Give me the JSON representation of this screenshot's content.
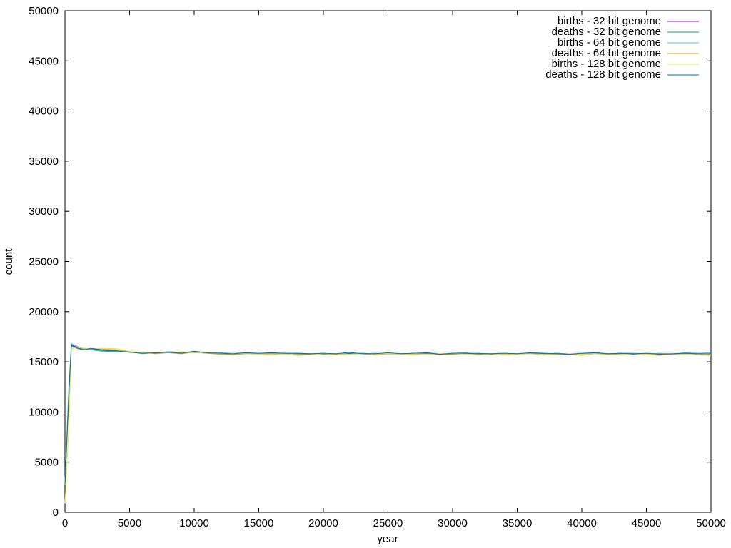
{
  "chart_data": {
    "type": "line",
    "title": "",
    "xlabel": "year",
    "ylabel": "count",
    "xlim": [
      0,
      50000
    ],
    "ylim": [
      0,
      50000
    ],
    "x_ticks": [
      "0",
      "5000",
      "10000",
      "15000",
      "20000",
      "25000",
      "30000",
      "35000",
      "40000",
      "45000",
      "50000"
    ],
    "y_ticks": [
      "0",
      "5000",
      "10000",
      "15000",
      "20000",
      "25000",
      "30000",
      "35000",
      "40000",
      "45000",
      "50000"
    ],
    "grid": false,
    "legend_position": "top-right",
    "x": [
      0,
      300,
      500,
      1000,
      1500,
      2000,
      3000,
      4000,
      5000,
      6000,
      7000,
      8000,
      9000,
      10000,
      11000,
      12000,
      13000,
      14000,
      15000,
      16000,
      17000,
      18000,
      19000,
      20000,
      21000,
      22000,
      23000,
      24000,
      25000,
      26000,
      27000,
      28000,
      29000,
      30000,
      31000,
      32000,
      33000,
      34000,
      35000,
      36000,
      37000,
      38000,
      39000,
      40000,
      41000,
      42000,
      43000,
      44000,
      45000,
      46000,
      47000,
      48000,
      49000,
      50000
    ],
    "series": [
      {
        "name": "births - 32 bit genome",
        "color": "#9400d3",
        "values": [
          2800,
          12000,
          16700,
          16400,
          16200,
          16300,
          16100,
          16000,
          16000,
          15900,
          15850,
          16000,
          15950,
          15900,
          15900,
          15850,
          15800,
          15850,
          15800,
          15850,
          15850,
          15800,
          15750,
          15800,
          15800,
          15850,
          15800,
          15800,
          15850,
          15800,
          15800,
          15850,
          15700,
          15800,
          15800,
          15800,
          15750,
          15800,
          15800,
          15850,
          15800,
          15800,
          15700,
          15800,
          15900,
          15800,
          15750,
          15800,
          15800,
          15700,
          15700,
          15800,
          15800,
          15700
        ]
      },
      {
        "name": "deaths - 32 bit genome",
        "color": "#009e73",
        "values": [
          2800,
          11500,
          16600,
          16300,
          16200,
          16250,
          16100,
          16050,
          15950,
          15900,
          15900,
          15950,
          15900,
          15950,
          15850,
          15800,
          15800,
          15850,
          15800,
          15800,
          15850,
          15800,
          15800,
          15750,
          15800,
          15800,
          15850,
          15800,
          15800,
          15800,
          15850,
          15800,
          15750,
          15800,
          15800,
          15850,
          15800,
          15800,
          15800,
          15800,
          15800,
          15850,
          15800,
          15700,
          15850,
          15800,
          15800,
          15750,
          15800,
          15800,
          15750,
          15800,
          15800,
          15750
        ]
      },
      {
        "name": "births - 64 bit genome",
        "color": "#56b4e9",
        "values": [
          3000,
          12500,
          16800,
          16500,
          16300,
          16200,
          16000,
          16000,
          16000,
          15800,
          15900,
          16000,
          15900,
          16000,
          15900,
          15900,
          15850,
          15900,
          15800,
          15900,
          15800,
          15850,
          15800,
          15850,
          15750,
          15900,
          15800,
          15850,
          15800,
          15800,
          15800,
          15900,
          15800,
          15850,
          15900,
          15800,
          15800,
          15850,
          15800,
          15900,
          15850,
          15800,
          15800,
          15800,
          15850,
          15800,
          15850,
          15850,
          15800,
          15850,
          15800,
          15900,
          15850,
          15900
        ]
      },
      {
        "name": "deaths - 64 bit genome",
        "color": "#e69f00",
        "values": [
          2900,
          11000,
          16500,
          16300,
          16250,
          16300,
          16250,
          16200,
          16000,
          15950,
          15800,
          15900,
          15800,
          15950,
          15850,
          15750,
          15700,
          15800,
          15750,
          15700,
          15800,
          15650,
          15700,
          15800,
          15700,
          15750,
          15800,
          15700,
          15800,
          15750,
          15700,
          15800,
          15700,
          15750,
          15800,
          15700,
          15800,
          15700,
          15750,
          15800,
          15700,
          15800,
          15750,
          15650,
          15800,
          15750,
          15700,
          15800,
          15700,
          15650,
          15750,
          15800,
          15700,
          15650
        ]
      },
      {
        "name": "births - 128 bit genome",
        "color": "#f0e442",
        "values": [
          900,
          8500,
          16300,
          16400,
          16350,
          16300,
          16350,
          16300,
          16050,
          15900,
          15950,
          15900,
          16000,
          15900,
          15950,
          15800,
          15850,
          15800,
          15750,
          15800,
          15750,
          15700,
          15700,
          15800,
          15800,
          15750,
          15800,
          15750,
          15850,
          15750,
          15800,
          15750,
          15800,
          15850,
          15750,
          15800,
          15700,
          15800,
          15750,
          15800,
          15750,
          15700,
          15800,
          15750,
          15800,
          15700,
          15750,
          15800,
          15750,
          15750,
          15800,
          15750,
          15800,
          15700
        ]
      },
      {
        "name": "deaths - 128 bit genome",
        "color": "#0072b2",
        "values": [
          2700,
          11800,
          16650,
          16350,
          16200,
          16350,
          16150,
          16100,
          15950,
          15850,
          15900,
          15950,
          15850,
          16050,
          15900,
          15850,
          15800,
          15900,
          15850,
          15900,
          15850,
          15850,
          15800,
          15850,
          15800,
          15950,
          15800,
          15800,
          15900,
          15800,
          15850,
          15900,
          15750,
          15850,
          15850,
          15800,
          15800,
          15850,
          15800,
          15900,
          15850,
          15800,
          15750,
          15850,
          15900,
          15800,
          15850,
          15800,
          15850,
          15750,
          15800,
          15850,
          15800,
          15800
        ]
      }
    ]
  }
}
